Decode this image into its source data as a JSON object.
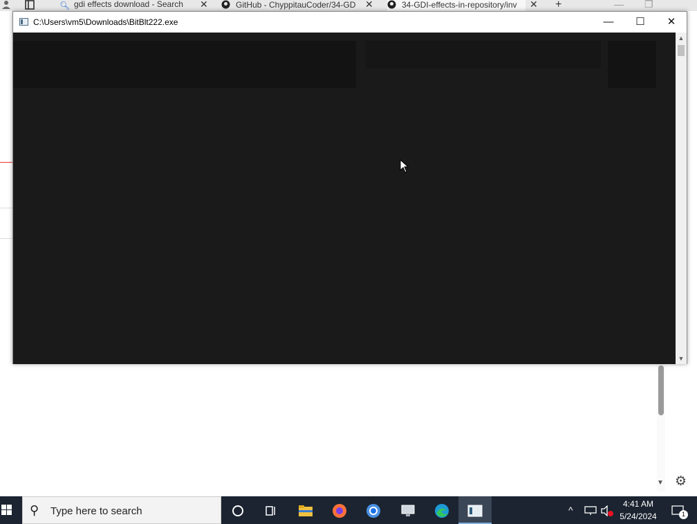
{
  "browser": {
    "tabs": [
      {
        "label": "gdi effects download - Search",
        "icon": "search-icon"
      },
      {
        "label": "GitHub - ChyppitauCoder/34-GD",
        "icon": "github-icon"
      },
      {
        "label": "34-GDI-effects-in-repository/inv",
        "icon": "github-icon"
      }
    ],
    "new_tab_label": "+"
  },
  "window": {
    "title": "C:\\Users\\vm5\\Downloads\\BitBlt222.exe",
    "minimize_label": "—",
    "maximize_label": "☐",
    "close_label": "✕"
  },
  "taskbar": {
    "search_placeholder": "Type here to search",
    "time": "4:41 AM",
    "date": "5/24/2024",
    "notification_count": "1"
  },
  "colors": {
    "console_bg": "#1a1a1a",
    "taskbar_bg": "#1b2430"
  }
}
